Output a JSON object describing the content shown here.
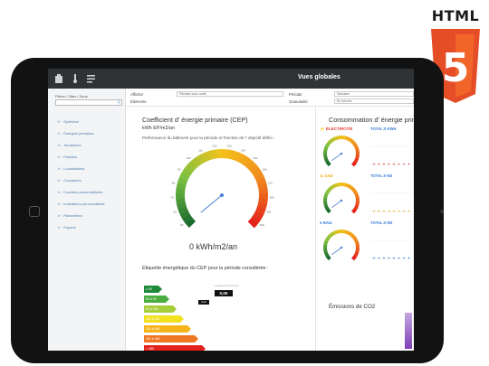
{
  "badge": {
    "label": "HTML",
    "number": "5",
    "color": "#e44d26"
  },
  "app": {
    "title": "Vues globales"
  },
  "sidebar": {
    "filter_label": "Filtres / Sites / Sous",
    "items": [
      {
        "label": "Synthèse"
      },
      {
        "label": "Énergies primaires"
      },
      {
        "label": "Tendances"
      },
      {
        "label": "Familles"
      },
      {
        "label": "Localisations"
      },
      {
        "label": "Compteurs"
      },
      {
        "label": "Courbes personnalisées"
      },
      {
        "label": "Indicateurs personnalisés"
      },
      {
        "label": "Paramètres"
      },
      {
        "label": "Exports"
      }
    ]
  },
  "toolbar": {
    "afficher_label": "Afficher",
    "afficher_value": "Période sous unité",
    "elements_label": "Éléments",
    "periode_label": "Période",
    "periode_value": "Semaine",
    "granularite_label": "Granularité",
    "granularite_value": "En heures"
  },
  "cep": {
    "title": "Coefficient d' énergie primaire (CEP)",
    "unit": "kWh EP/m2/an",
    "description": "Performance du bâtiment pour la période et fonction de l' objectif défini -",
    "value": "0 kWh/m2/an",
    "gauge_ticks": [
      "50",
      "60",
      "70",
      "80",
      "90",
      "100",
      "110",
      "120",
      "130",
      "140",
      "150",
      "160",
      "170",
      "180",
      "190",
      "200"
    ],
    "gauge_reading": 0
  },
  "label_section": {
    "title": "Étiquette énergétique du CEP pour la période considérée :",
    "marker_head": "Logement économe",
    "marker_value": "0,00",
    "marker_small": "0,00",
    "classes": [
      {
        "label": "≤ 50",
        "color": "#1f8a3a"
      },
      {
        "label": "51 à 90",
        "color": "#4cad3f"
      },
      {
        "label": "91 à 150",
        "color": "#a6cd3a"
      },
      {
        "label": "151 à 230",
        "color": "#f2e11e"
      },
      {
        "label": "231 à 330",
        "color": "#f6b41b"
      },
      {
        "label": "331 à 450",
        "color": "#ef7722"
      },
      {
        "label": "> 450",
        "color": "#e3221b"
      }
    ]
  },
  "consumption": {
    "title": "Consommation d' énergie primaire",
    "meters": [
      {
        "name": "ÉLECTRICITÉ",
        "color": "#e53935",
        "total": "TOTAL:0 KWH",
        "reading": 0
      },
      {
        "name": "GAZ",
        "color": "#f2a900",
        "total": "TOTAL:0 M3",
        "reading": 0
      },
      {
        "name": "EAU",
        "color": "#1e6fd9",
        "total": "TOTAL:0 M3",
        "reading": 0
      }
    ]
  },
  "co2": {
    "title": "Émissions de CO2"
  }
}
